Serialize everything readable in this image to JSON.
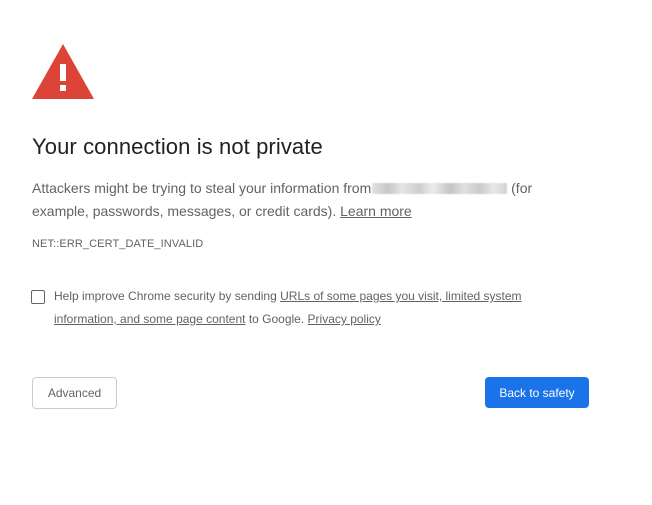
{
  "icon": {
    "name": "warning-triangle-icon",
    "color": "#db4437",
    "glyph": "!"
  },
  "heading": {
    "title": "Your connection is not private"
  },
  "explanation": {
    "text_before": "Attackers might be trying to steal your information from",
    "host_redacted": true,
    "text_after": "(for example, passwords, messages, or credit cards).",
    "learn_more": "Learn more"
  },
  "error_code": "NET::ERR_CERT_DATE_INVALID",
  "optin": {
    "checked": false,
    "text_before": "Help improve Chrome security by sending",
    "link_urls": "URLs of some pages you visit, limited system information, and some page content",
    "text_middle": "to Google.",
    "privacy_policy": "Privacy policy"
  },
  "buttons": {
    "advanced_label": "Advanced",
    "back_to_safety_label": "Back to safety",
    "primary_color": "#1a73e8"
  }
}
